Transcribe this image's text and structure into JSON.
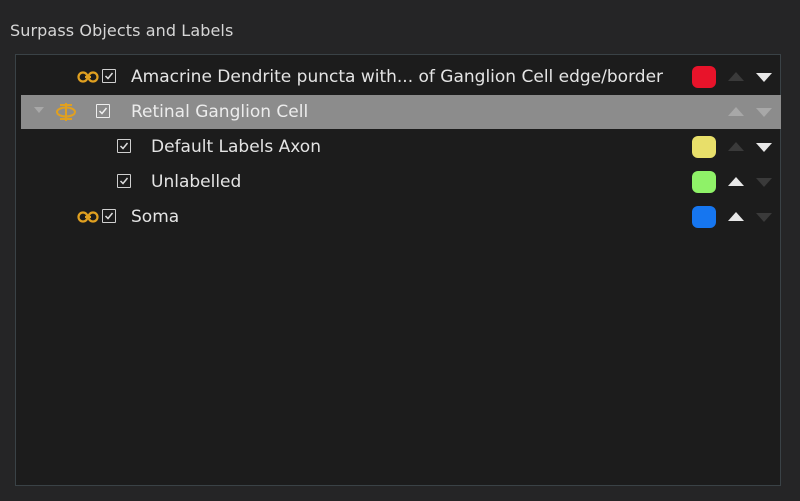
{
  "panel": {
    "title": "Surpass Objects and Labels"
  },
  "rows": [
    {
      "label": "Amacrine Dendrite puncta with... of Ganglion Cell edge/border",
      "checked": true,
      "icon": "chain-link-icon",
      "color": "#e8132a",
      "up_enabled": false,
      "down_enabled": true
    },
    {
      "label": "Retinal Ganglion Cell",
      "checked": true,
      "icon": "linked-group-icon",
      "selected": true,
      "expanded": true,
      "up_enabled": false,
      "down_enabled": false
    },
    {
      "label": "Default Labels Axon",
      "checked": true,
      "color": "#e8df6a",
      "up_enabled": false,
      "down_enabled": true
    },
    {
      "label": "Unlabelled",
      "checked": true,
      "color": "#8ff268",
      "up_enabled": true,
      "down_enabled": false
    },
    {
      "label": "Soma",
      "checked": true,
      "icon": "chain-link-icon",
      "color": "#1676f0",
      "up_enabled": true,
      "down_enabled": false
    }
  ],
  "colors": {
    "accent_icon": "#e0a020",
    "selected_row": "#8c8c8c"
  }
}
